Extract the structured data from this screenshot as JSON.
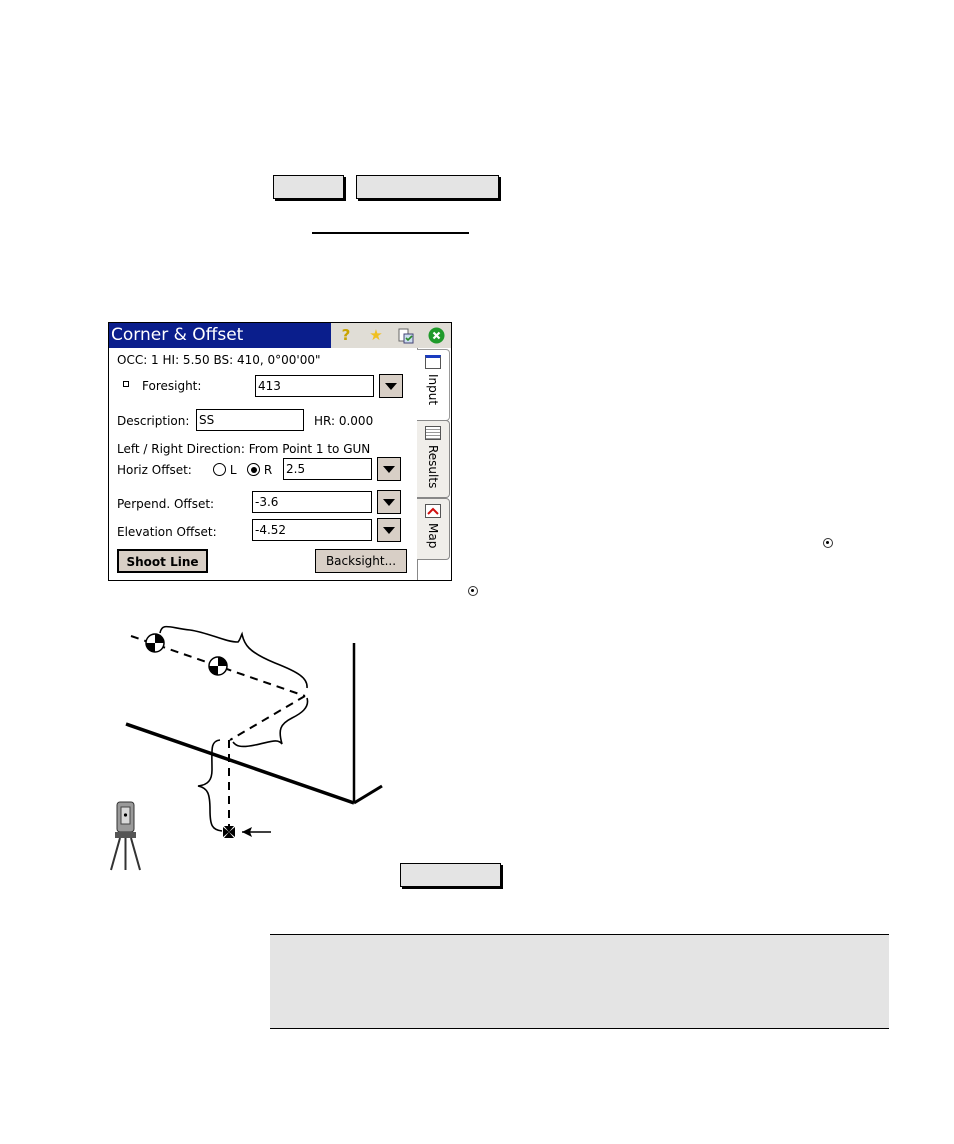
{
  "dialog": {
    "title": "Corner & Offset",
    "title_icons": [
      "help-icon",
      "favorites-star-icon",
      "task-checklist-icon",
      "close-icon"
    ],
    "status_line": "OCC: 1  HI: 5.50  BS: 410, 0°00'00\"",
    "foresight": {
      "label": "Foresight:",
      "value": "413"
    },
    "description": {
      "label": "Description:",
      "value": "SS"
    },
    "hr": "HR: 0.000",
    "direction_note": "Left / Right Direction: From Point 1 to GUN",
    "horiz_offset": {
      "label": "Horiz Offset:",
      "options": [
        "L",
        "R"
      ],
      "selected": "R",
      "value": "2.5"
    },
    "perpend_offset": {
      "label": "Perpend. Offset:",
      "value": "-3.6"
    },
    "elevation_offset": {
      "label": "Elevation Offset:",
      "value": "-4.52"
    },
    "shoot_line_button": "Shoot Line",
    "backsight_button": "Backsight...",
    "tabs": [
      {
        "label": "Input",
        "active": true
      },
      {
        "label": "Results",
        "active": false
      },
      {
        "label": "Map",
        "active": false
      }
    ]
  },
  "colors": {
    "titlebar": "#0a1e8c",
    "button_face": "#d8cfc6",
    "callout_fill": "#e4e4e4"
  }
}
